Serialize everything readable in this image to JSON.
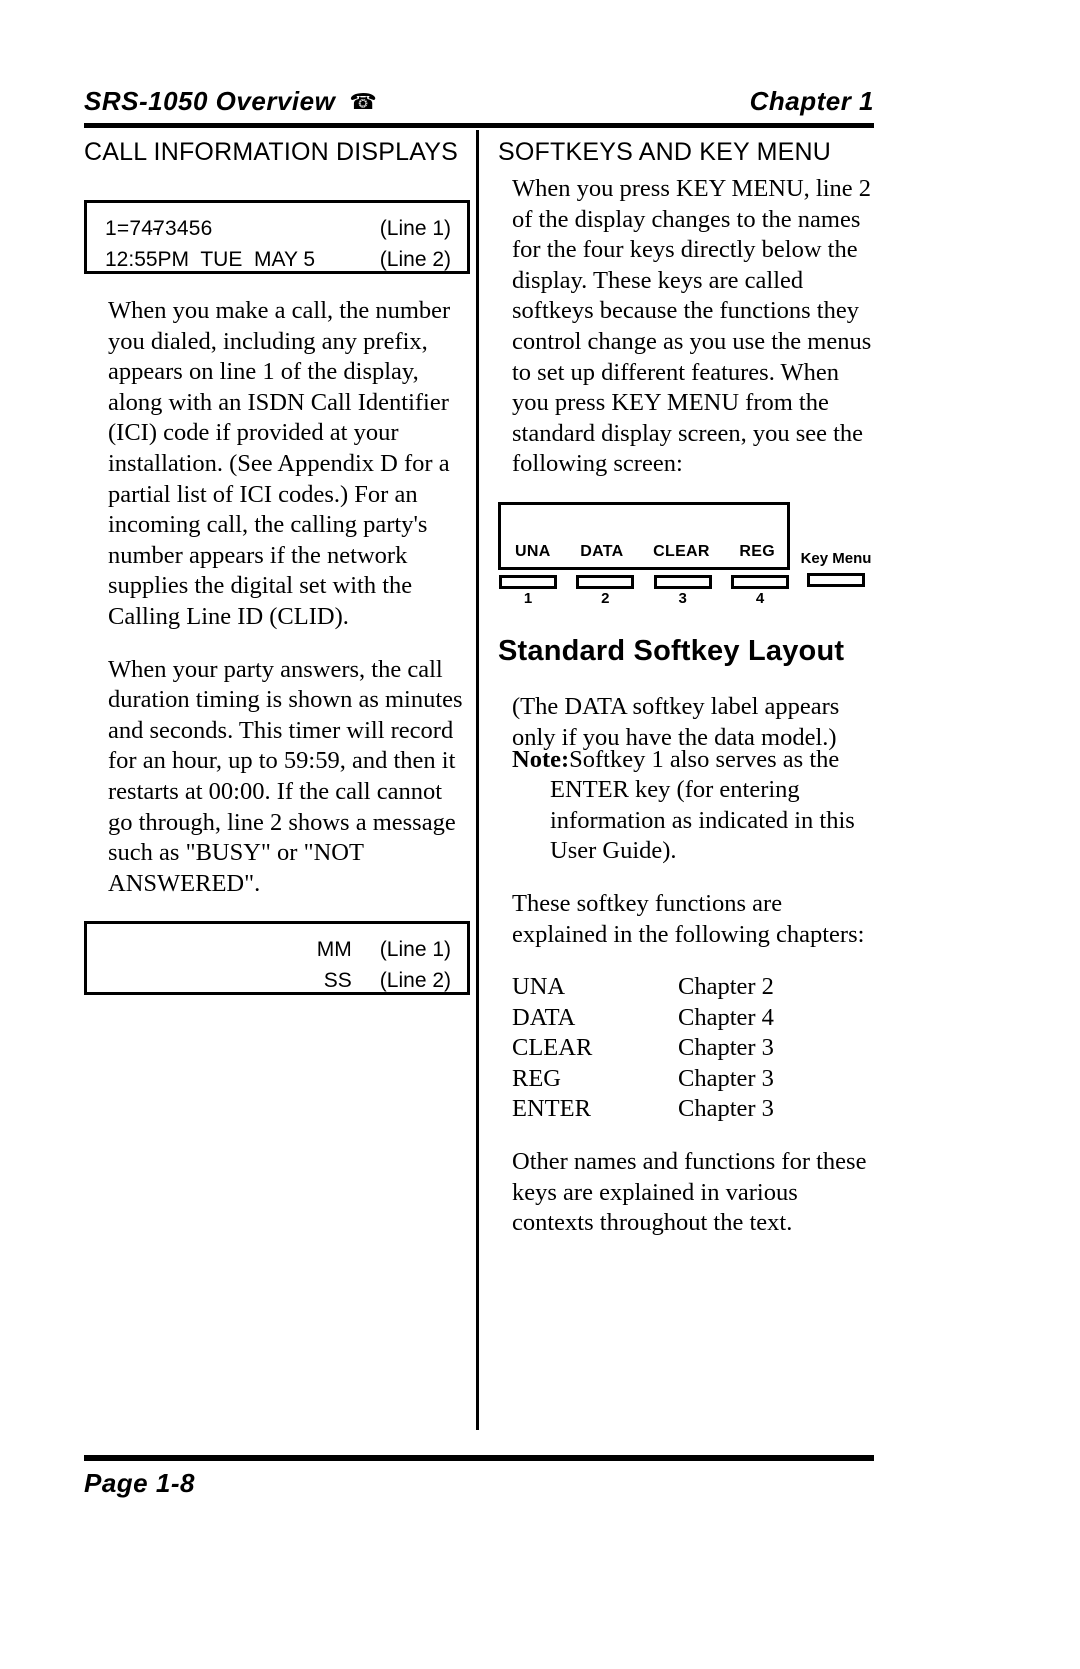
{
  "running_head": {
    "left_title": "SRS-1050 Overview",
    "phone_icon": "☎",
    "right_title": "Chapter 1"
  },
  "left_column": {
    "heading": "CALL INFORMATION DISPLAYS",
    "call_display": {
      "line1_prefix": "1=747",
      "line1_dash": "-",
      "line1_suffix": "3456",
      "line1_label": "(Line 1)",
      "line2_value": "12:55PM  TUE  MAY 5",
      "line2_label": "(Line 2)"
    },
    "paragraph_1": "When you make a call, the number you dialed, including any prefix, appears on line 1 of the display, along with an ISDN Call Identifier (ICI) code if provided at your installation.  (See Appendix D for a partial list of ICI codes.)  For an incoming call, the calling party's number appears if the network supplies the digital set with the Calling Line ID (CLID).",
    "paragraph_2": "When your party answers, the call duration timing is shown as minutes and seconds.  This timer will record for an hour, up to 59:59, and then it restarts at 00:00.  If the call cannot go through, line 2 shows a message such as \"BUSY\" or \"NOT ANSWERED\".",
    "timer_display": {
      "line1_value": "MM",
      "line1_label": "(Line 1)",
      "line2_value": "SS",
      "line2_label": "(Line 2)"
    }
  },
  "right_column": {
    "heading": "SOFTKEYS AND KEY MENU",
    "paragraph_1": "When you press KEY MENU, line 2 of the display changes to the names for the four keys directly below the display.  These keys are called softkeys because the functions they control change as you use the menus to set up different features.  When you press KEY MENU from the standard display screen, you see the following screen:",
    "softkey_figure": {
      "screen_labels": [
        "UNA",
        "DATA",
        "CLEAR",
        "REG"
      ],
      "button_numbers": [
        "1",
        "2",
        "3",
        "4"
      ],
      "key_menu_label": "Key Menu"
    },
    "figure_caption": "Standard Softkey Layout",
    "paragraph_2": "(The DATA softkey label appears only if you have the data model.)",
    "note": {
      "label": "Note:",
      "text": "Softkey 1 also serves as the ENTER key (for entering information as indicated in this User Guide)."
    },
    "paragraph_3": "These softkey functions are explained in the following chapters:",
    "chapter_refs": [
      {
        "key": "UNA",
        "value": "Chapter 2"
      },
      {
        "key": "DATA",
        "value": "Chapter 4"
      },
      {
        "key": "CLEAR",
        "value": "Chapter 3"
      },
      {
        "key": "REG",
        "value": "Chapter 3"
      },
      {
        "key": "ENTER",
        "value": "Chapter 3"
      }
    ],
    "paragraph_4": "Other names and functions for these keys are explained in various contexts throughout the text."
  },
  "footer": {
    "page_label": "Page 1-8"
  }
}
